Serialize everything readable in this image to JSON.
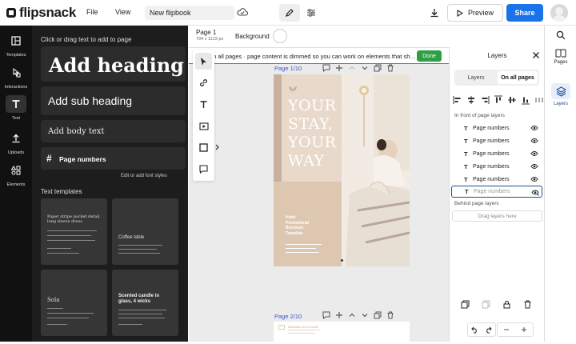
{
  "app": {
    "logo_text": "flipsnack"
  },
  "topbar": {
    "menu_file": "File",
    "menu_view": "View",
    "flipbook_name": "New flipbook",
    "preview_label": "Preview",
    "share_label": "Share"
  },
  "left_rail": {
    "items": [
      {
        "label": "Templates",
        "icon": "templates-icon"
      },
      {
        "label": "Interactions",
        "icon": "interactions-icon"
      },
      {
        "label": "Text",
        "icon": "text-icon"
      },
      {
        "label": "Uploads",
        "icon": "upload-icon"
      },
      {
        "label": "Elements",
        "icon": "elements-icon"
      }
    ]
  },
  "text_panel": {
    "hint": "Click or drag text to add to page",
    "add_heading": "Add heading",
    "add_subheading": "Add sub heading",
    "add_body": "Add body text",
    "page_numbers": "Page numbers",
    "font_styles_link": "Edit or add font styles",
    "templates_title": "Text templates",
    "templates": [
      {
        "title": "Paper stripe pocket detail long sleeve dress"
      },
      {
        "title": "Coffee table"
      },
      {
        "title": "Sola"
      },
      {
        "title": "Scented candle in glass, 4 wicks"
      }
    ]
  },
  "canvas": {
    "page_label": "Page 1",
    "page_size": "794 x 1123 px",
    "background_label": "Background",
    "info_text": "n all pages · page content is dimmed so you can work on elements that sh…",
    "done_label": "Done",
    "page1_header": "Page 1/10",
    "page2_header": "Page 2/10",
    "page1": {
      "headline_lines": [
        "YOUR",
        "STAY,",
        "YOUR",
        "WAY"
      ],
      "brochure_lines": [
        "Hotel",
        "Promotional",
        "Brochure",
        "Template"
      ]
    },
    "page2": {
      "text_line": "Welcome to our hotel"
    }
  },
  "layers_panel": {
    "title": "Layers",
    "tab_layers": "Layers",
    "tab_all_pages": "On all pages",
    "front_section": "In front of page layers",
    "layers": [
      {
        "name": "Page numbers",
        "selected": false
      },
      {
        "name": "Page numbers",
        "selected": false
      },
      {
        "name": "Page numbers",
        "selected": false
      },
      {
        "name": "Page numbers",
        "selected": false
      },
      {
        "name": "Page numbers",
        "selected": false
      },
      {
        "name": "Page numbers",
        "selected": true
      }
    ],
    "behind_section": "Behind page layers",
    "dropzone": "Drag layers here"
  },
  "right_rail": {
    "pages_label": "Pages",
    "layers_label": "Layers"
  },
  "colors": {
    "accent_blue": "#1a73e8",
    "done_green": "#2ea043",
    "page_beige": "#e8d9ca",
    "page_header_blue": "#3a56c5"
  }
}
